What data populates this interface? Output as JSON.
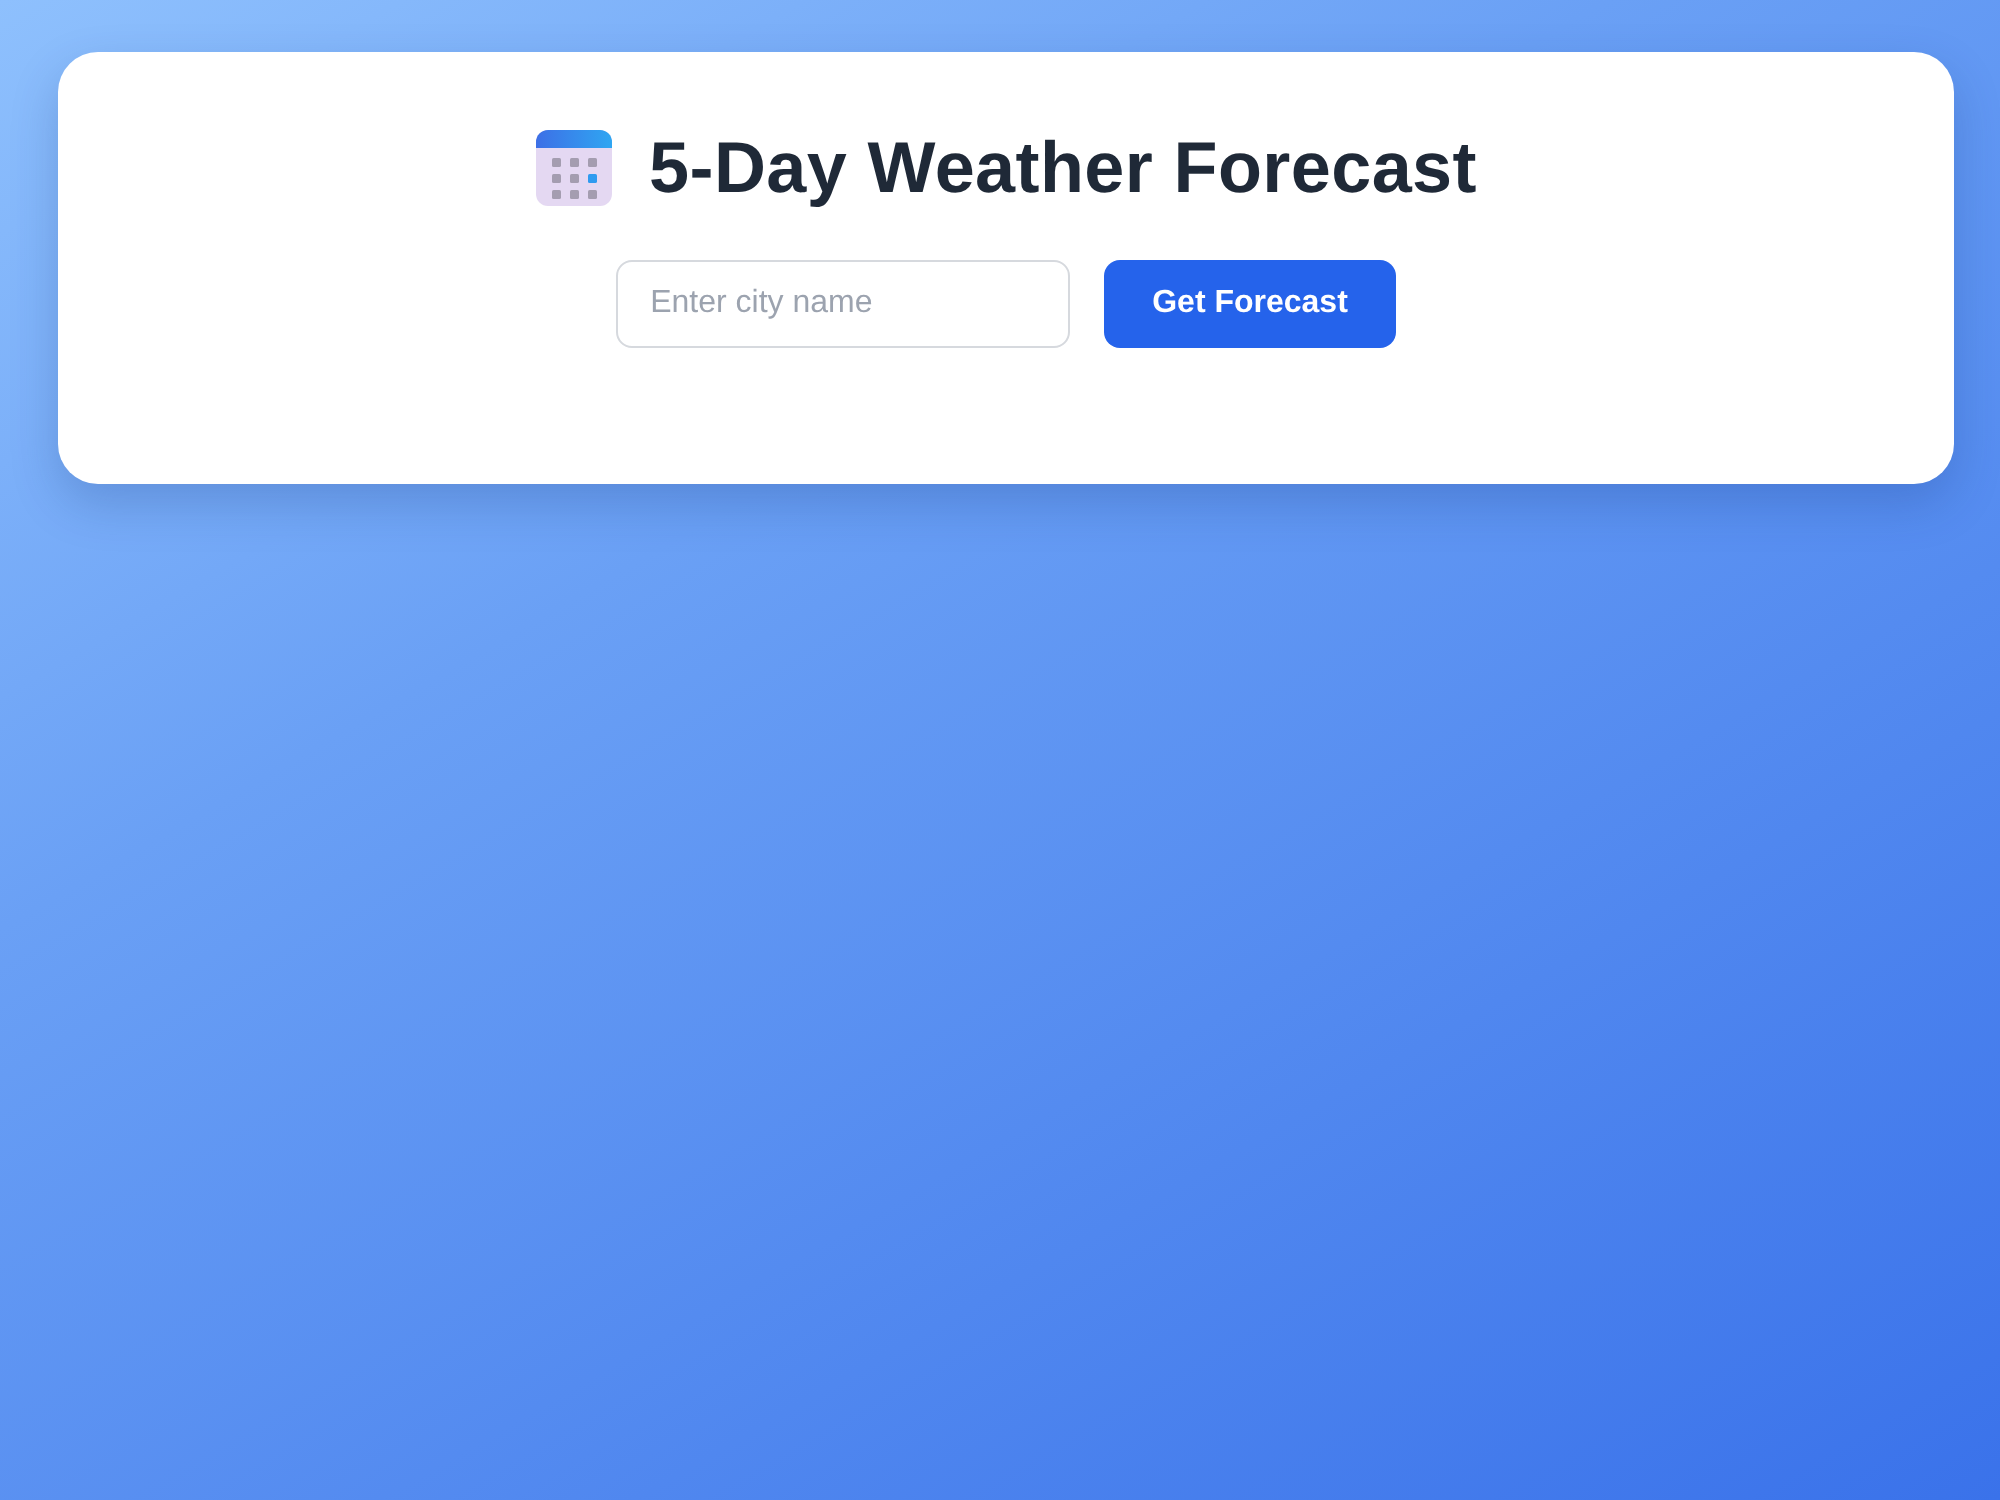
{
  "header": {
    "title": "5-Day Weather Forecast"
  },
  "search": {
    "placeholder": "Enter city name",
    "button": "Get Forecast"
  }
}
